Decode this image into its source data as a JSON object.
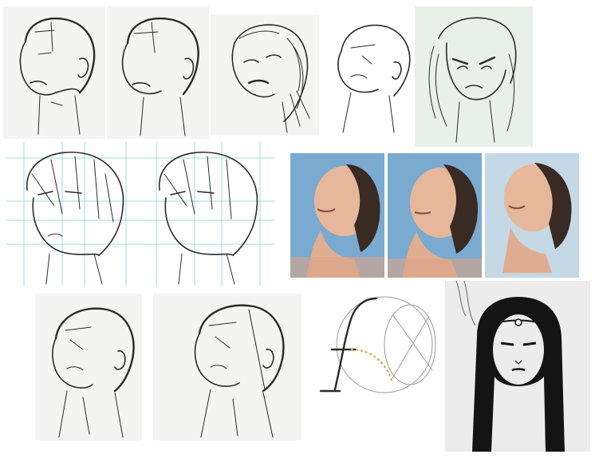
{
  "palette": {
    "paper": "#f4f4f2",
    "paper_grey": "#ececec",
    "paper_green": "#e9efe9",
    "ink": "#2a2a2a",
    "guide_cyan": "#9fdede",
    "guide_orange": "#e8a020",
    "photo_blue_bg": "#7aaad0",
    "photo_hair": "#3a2a24",
    "photo_skin": "#e6b79a"
  },
  "tiles": [
    {
      "name": "sketch-head-1",
      "kind": "pencil sketch, male head looking up"
    },
    {
      "name": "sketch-head-2",
      "kind": "pencil sketch, male head looking up"
    },
    {
      "name": "sketch-woman-curly",
      "kind": "pencil sketch, woman looking up"
    },
    {
      "name": "sketch-bald-outline",
      "kind": "line drawing, bald head looking up"
    },
    {
      "name": "sketch-angry-woman",
      "kind": "sketch, woman frowning"
    },
    {
      "name": "anime-heads-guides",
      "kind": "two anime heads with construction guides"
    },
    {
      "name": "photo-woman-1",
      "kind": "photo, woman looking up"
    },
    {
      "name": "photo-woman-2",
      "kind": "photo, woman looking up"
    },
    {
      "name": "photo-woman-3",
      "kind": "photo, woman looking up"
    },
    {
      "name": "sketch-neck-3",
      "kind": "pencil sketch, head and neck"
    },
    {
      "name": "sketch-neck-4",
      "kind": "pencil sketch, head and neck"
    },
    {
      "name": "construction-sphere",
      "kind": "head construction diagram"
    },
    {
      "name": "ink-woman-long-hair",
      "kind": "ink drawing, woman with long hair and circlet"
    }
  ]
}
